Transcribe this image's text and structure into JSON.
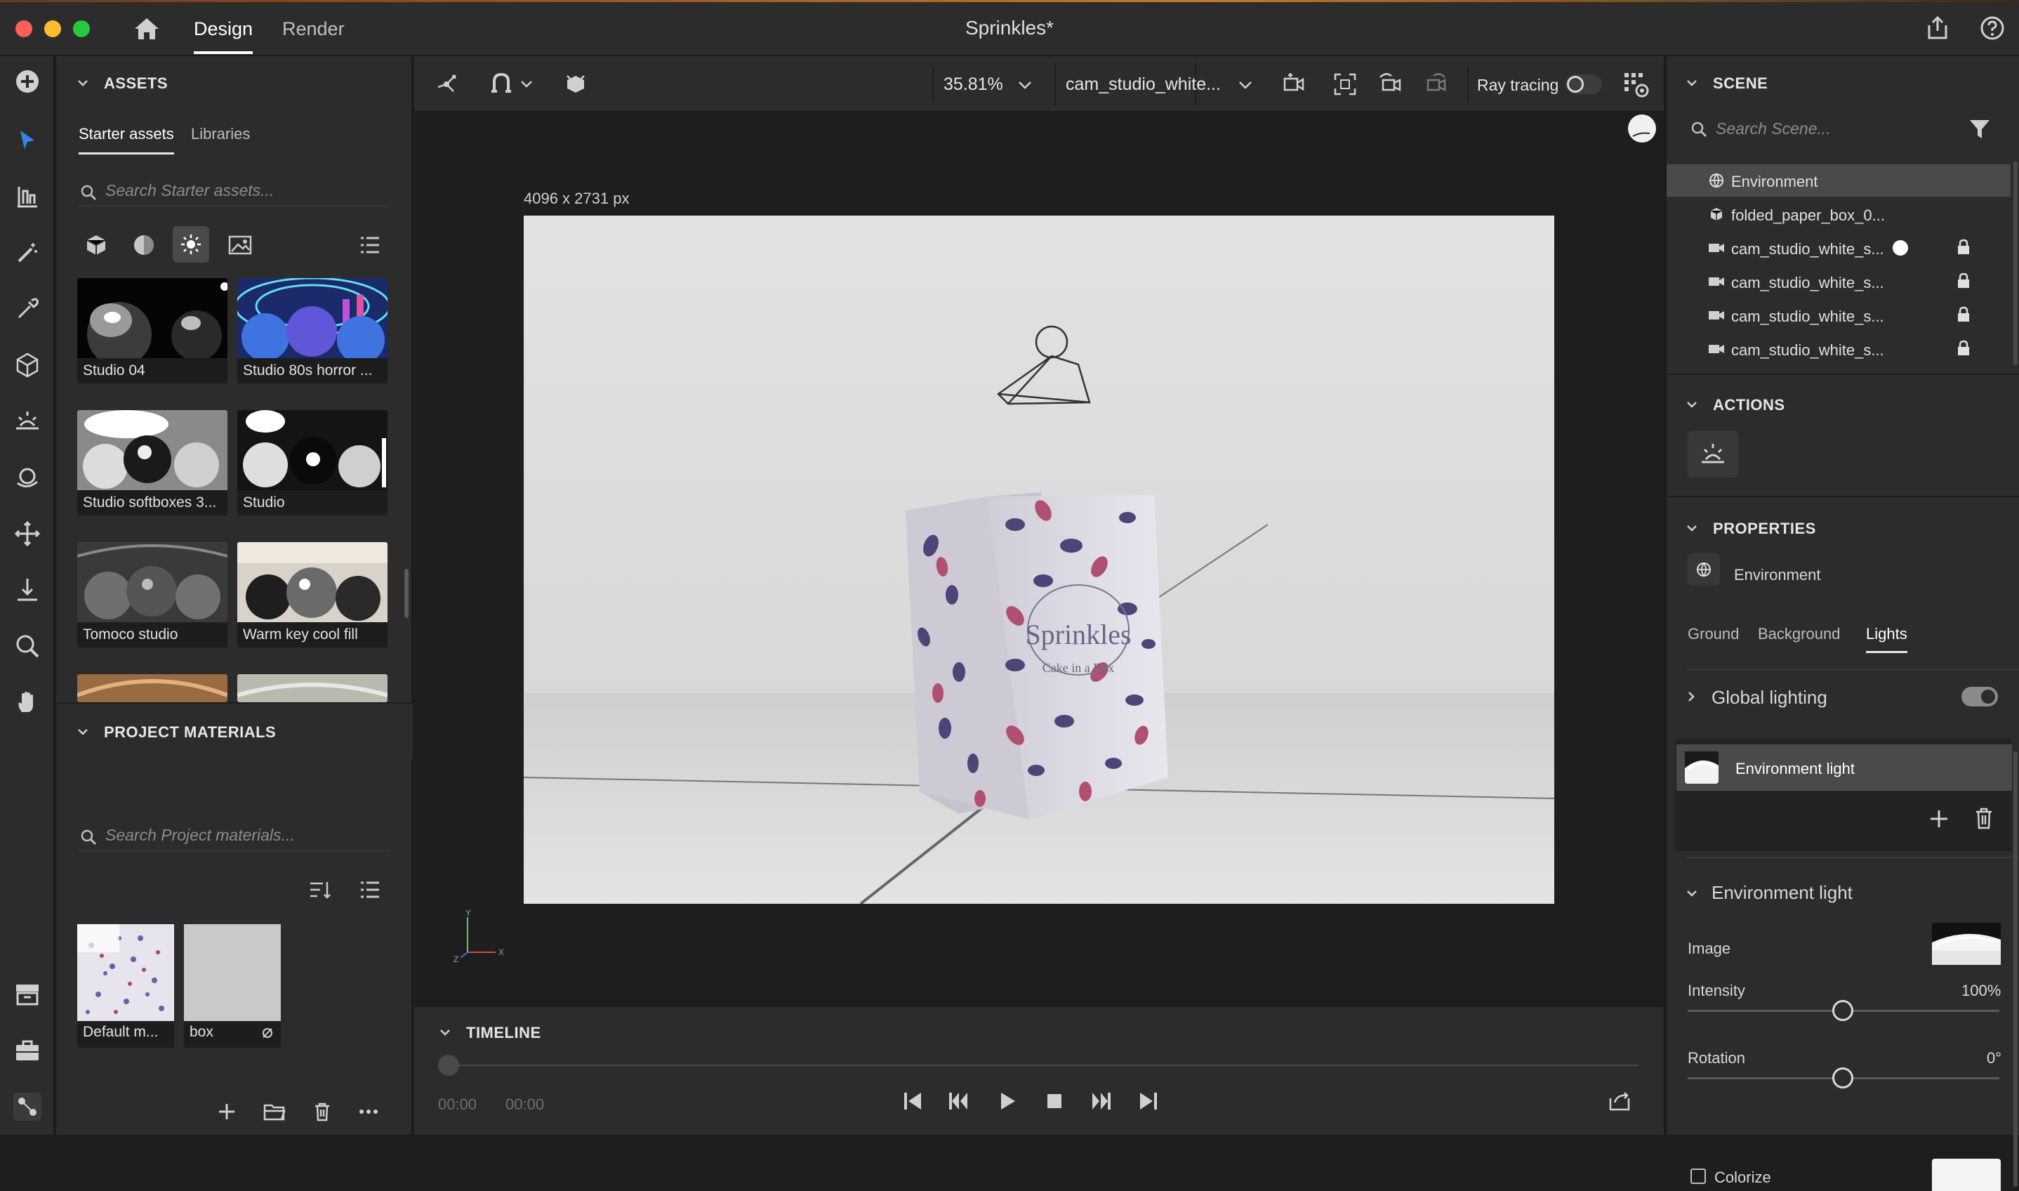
{
  "app": {
    "title": "Sprinkles*",
    "tabs": [
      {
        "label": "Design",
        "active": true
      },
      {
        "label": "Render",
        "active": false
      }
    ]
  },
  "assets": {
    "header": "ASSETS",
    "subtabs": [
      {
        "label": "Starter assets",
        "active": true
      },
      {
        "label": "Libraries",
        "active": false
      }
    ],
    "search_placeholder": "Search Starter assets...",
    "items": [
      {
        "label": "Studio 04"
      },
      {
        "label": "Studio 80s horror ..."
      },
      {
        "label": "Studio softboxes 3..."
      },
      {
        "label": "Studio"
      },
      {
        "label": "Tomoco studio"
      },
      {
        "label": "Warm key cool fill"
      }
    ]
  },
  "materials": {
    "header": "PROJECT MATERIALS",
    "search_placeholder": "Search Project materials...",
    "items": [
      {
        "label": "Default m..."
      },
      {
        "label": "box"
      }
    ]
  },
  "toolbar": {
    "zoom": "35.81%",
    "camera": "cam_studio_white...",
    "ray_tracing_label": "Ray tracing",
    "ray_tracing_on": false
  },
  "canvas": {
    "size_label": "4096 x 2731 px",
    "box_brand": "Sprinkles",
    "box_tagline": "Cake in a Box",
    "axis_y": "Y",
    "axis_x": "X",
    "axis_z": "Z"
  },
  "timeline": {
    "header": "TIMELINE",
    "time_current": "00:00",
    "time_total": "00:00"
  },
  "scene": {
    "header": "SCENE",
    "search_placeholder": "Search Scene...",
    "items": [
      {
        "label": "Environment",
        "icon": "globe-icon",
        "selected": true
      },
      {
        "label": "folded_paper_box_0...",
        "icon": "cube-icon"
      },
      {
        "label": "cam_studio_white_s...",
        "icon": "camera-icon",
        "active_dot": true,
        "locked": true
      },
      {
        "label": "cam_studio_white_s...",
        "icon": "camera-icon",
        "locked": true
      },
      {
        "label": "cam_studio_white_s...",
        "icon": "camera-icon",
        "locked": true
      },
      {
        "label": "cam_studio_white_s...",
        "icon": "camera-icon",
        "locked": true
      }
    ]
  },
  "actions": {
    "header": "ACTIONS"
  },
  "properties": {
    "header": "PROPERTIES",
    "object": "Environment",
    "tabs": [
      {
        "label": "Ground",
        "active": false
      },
      {
        "label": "Background",
        "active": false
      },
      {
        "label": "Lights",
        "active": true
      }
    ],
    "global_lighting": {
      "label": "Global lighting",
      "enabled": true
    },
    "light_item": "Environment light",
    "env_light_header": "Environment light",
    "image_label": "Image",
    "intensity": {
      "label": "Intensity",
      "value": "100%"
    },
    "rotation": {
      "label": "Rotation",
      "value": "0°"
    },
    "colorize_label": "Colorize"
  }
}
